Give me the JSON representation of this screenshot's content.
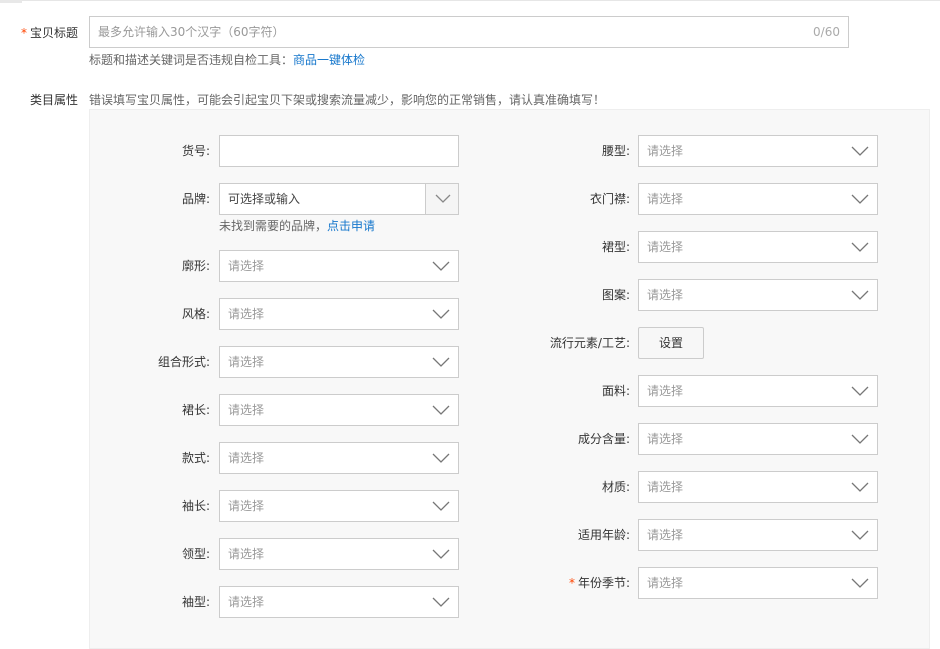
{
  "title_row": {
    "label": "宝贝标题",
    "required_mark": "*",
    "placeholder": "最多允许输入30个汉字（60字符）",
    "counter": "0/60",
    "hint_text": "标题和描述关键词是否违规自检工具：",
    "hint_link": "商品一键体检"
  },
  "category": {
    "label": "类目属性",
    "warning": "错误填写宝贝属性，可能会引起宝贝下架或搜索流量减少，影响您的正常销售，请认真准确填写！"
  },
  "select_placeholder": "请选择",
  "left_fields": {
    "huohao": "货号:",
    "brand": "品牌:",
    "brand_placeholder": "可选择或输入",
    "brand_hint": "未找到需要的品牌，",
    "brand_hint_link": "点击申请",
    "kuoxing": "廓形:",
    "fengge": "风格:",
    "zuhe": "组合形式:",
    "qunchang": "裙长:",
    "kuanshi": "款式:",
    "xiuchang": "袖长:",
    "lingxing": "领型:",
    "xiuxing": "袖型:"
  },
  "right_fields": {
    "yaoxing": "腰型:",
    "yimenjin": "衣门襟:",
    "qunxing": "裙型:",
    "tuan": "图案:",
    "liuxing": "流行元素/工艺:",
    "set_button": "设置",
    "mianliao": "面料:",
    "chengfen": "成分含量:",
    "caizhi": "材质:",
    "nianling": "适用年龄:",
    "nianfen": "年份季节:",
    "required_mark": "*"
  }
}
